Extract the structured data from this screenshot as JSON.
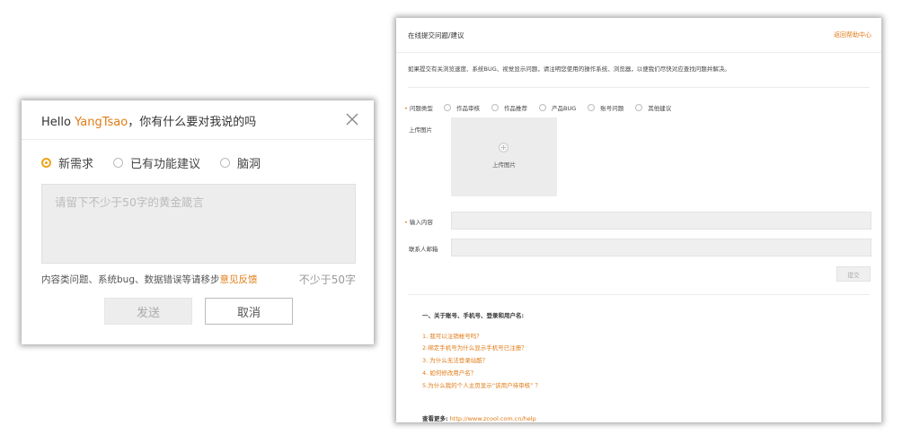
{
  "dialog": {
    "greeting": "Hello ",
    "username": "YangTsao",
    "question": "，你有什么要对我说的吗",
    "radio_options": [
      {
        "label": "新需求",
        "selected": true
      },
      {
        "label": "已有功能建议",
        "selected": false
      },
      {
        "label": "脑洞",
        "selected": false
      }
    ],
    "textarea_placeholder": "请留下不少于50字的黄金箴言",
    "hint_text": "内容类问题、系统bug、数据错误等请移步",
    "hint_link": "意见反馈",
    "char_count_hint": "不少于50字",
    "send_label": "发送",
    "cancel_label": "取消",
    "accent_color": "#e07b16"
  },
  "panel": {
    "title": "在线提交问题/建议",
    "back_link": "返回帮助中心",
    "description": "如果提交有关浏览速度、系统BUG、视觉显示问题，请注明您使用的操作系统、浏览器，以便我们尽快对应查找问题并解决。",
    "type_label": "问题类型",
    "type_options": [
      "作品审核",
      "作品推荐",
      "产品BUG",
      "账号问题",
      "其他建议"
    ],
    "upload_label": "上传图片",
    "upload_button_text": "上传图片",
    "content_label": "输入内容",
    "email_label": "联系人邮箱",
    "submit_label": "提交",
    "faq_title": "一、关于账号、手机号、登录和用户名:",
    "faq_items": [
      "1. 我可以注销帐号吗？",
      "2.绑定手机号为什么显示手机号已注册？",
      "3. 为什么无法登录站酷？",
      "4. 如何修改用户名？",
      "5.为什么我的个人主页显示“该用户待审核” ？"
    ],
    "more_label": "查看更多:",
    "more_url": " http://www.zcool.com.cn/help"
  }
}
